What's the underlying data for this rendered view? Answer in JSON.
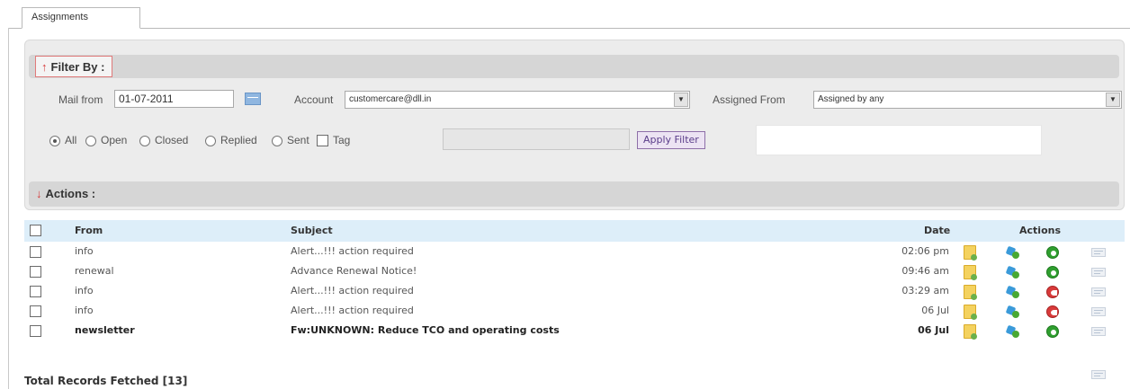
{
  "tab": {
    "label": "Assignments"
  },
  "filter": {
    "title": "Filter By :",
    "mail_from_label": "Mail from",
    "mail_from_value": "01-07-2011",
    "account_label": "Account",
    "account_value": "customercare@dll.in",
    "assigned_from_label": "Assigned From",
    "assigned_from_value": "Assigned by any",
    "status_options": [
      "All",
      "Open",
      "Closed",
      "Replied",
      "Sent"
    ],
    "status_selected": "All",
    "tag_label": "Tag",
    "apply_button": "Apply Filter"
  },
  "actions_section": {
    "title": "Actions :"
  },
  "table": {
    "columns": {
      "from": "From",
      "subject": "Subject",
      "date": "Date",
      "actions": "Actions"
    },
    "rows": [
      {
        "from": "info",
        "subject": "Alert...!!! action required",
        "date": "02:06 pm",
        "status": "open",
        "unread": false
      },
      {
        "from": "renewal",
        "subject": "Advance Renewal Notice!",
        "date": "09:46 am",
        "status": "open",
        "unread": false
      },
      {
        "from": "info",
        "subject": "Alert...!!! action required",
        "date": "03:29 am",
        "status": "closed",
        "unread": false
      },
      {
        "from": "info",
        "subject": "Alert...!!! action required",
        "date": "06 Jul",
        "status": "closed",
        "unread": false
      },
      {
        "from": "newsletter",
        "subject": "Fw:UNKNOWN: Reduce TCO and operating costs",
        "date": "06 Jul",
        "status": "open",
        "unread": true
      }
    ]
  },
  "footer": {
    "total": "Total Records Fetched [13]"
  },
  "colors": {
    "accent_red": "#d63a3a",
    "header_blue": "#ddeef9",
    "status_open": "#2f9e2f",
    "status_closed": "#d83a3a"
  }
}
